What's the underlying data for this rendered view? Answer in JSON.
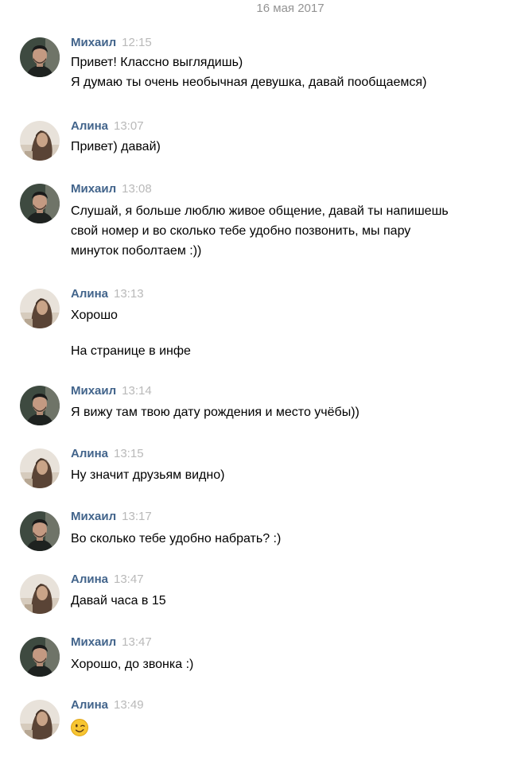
{
  "chat": {
    "date": "16 мая 2017",
    "messages": [
      {
        "author": "Михаил",
        "time": "12:15",
        "lines": [
          "Привет! Классно выглядишь)",
          "Я думаю ты очень необычная девушка, давай пообщаемся)"
        ]
      },
      {
        "author": "Алина",
        "time": "13:07",
        "lines": [
          "Привет) давай)"
        ]
      },
      {
        "author": "Михаил",
        "time": "13:08",
        "lines": [
          "Слушай, я больше люблю живое общение, давай ты напишешь",
          "свой номер и во сколько тебе удобно позвонить, мы пару",
          "минуток поболтаем :))"
        ]
      },
      {
        "author": "Алина",
        "time": "13:13",
        "lines": [
          "Хорошо",
          "На странице в инфе"
        ]
      },
      {
        "author": "Михаил",
        "time": "13:14",
        "lines": [
          "Я вижу там твою дату рождения и место учёбы))"
        ]
      },
      {
        "author": "Алина",
        "time": "13:15",
        "lines": [
          "Ну значит друзьям видно)"
        ]
      },
      {
        "author": "Михаил",
        "time": "13:17",
        "lines": [
          "Во сколько тебе удобно набрать? :)"
        ]
      },
      {
        "author": "Алина",
        "time": "13:47",
        "lines": [
          "Давай часа в 15"
        ]
      },
      {
        "author": "Михаил",
        "time": "13:47",
        "lines": [
          "Хорошо, до звонка :)"
        ]
      },
      {
        "author": "Алина",
        "time": "13:49",
        "emoji": "winking-face-emoji"
      }
    ]
  },
  "colors": {
    "author_link": "#42648b",
    "timestamp": "#b9b9b9",
    "date_separator": "#939393",
    "message_text": "#000000"
  },
  "icons": {
    "mikhail_avatar": "man-portrait-avatar",
    "alina_avatar": "woman-portrait-avatar",
    "emoji": "winking-face-emoji"
  }
}
